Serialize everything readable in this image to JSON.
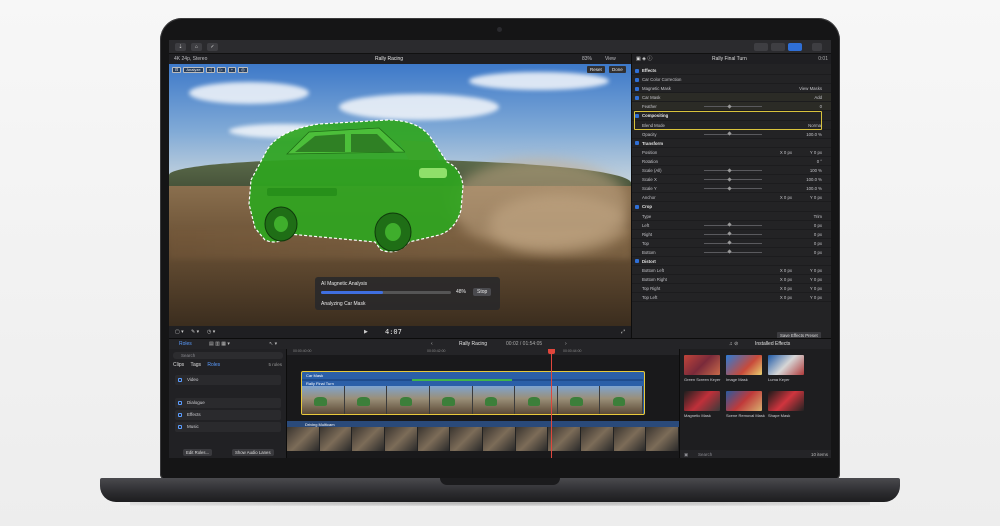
{
  "window": {
    "format_label": "4K 24p, Stereo",
    "project_name": "Rally Racing",
    "zoom": "83%",
    "view_menu": "View"
  },
  "viewer_tools": {
    "reset": "Reset",
    "done": "Done",
    "analyze": "Analyze"
  },
  "analysis": {
    "title": "AI Magnetic Analysis",
    "progress_percent": 48,
    "progress_label": "48%",
    "stop_label": "Stop",
    "status": "Analyzing Car Mask"
  },
  "transport": {
    "timecode": "4:07"
  },
  "inspector": {
    "clip_title": "Rally Final Turn",
    "duration": "0:01",
    "rows": [
      {
        "type": "section",
        "label": "Effects"
      },
      {
        "type": "check",
        "label": "Car Color Correction",
        "val": ""
      },
      {
        "type": "check",
        "label": "Magnetic Mask",
        "val": "View Masks"
      },
      {
        "type": "check",
        "label": "Car Mask",
        "val": "Add"
      },
      {
        "type": "slider",
        "label": "Feather",
        "val": "0"
      },
      {
        "type": "section",
        "label": "Compositing"
      },
      {
        "type": "plain",
        "label": "Blend Mode",
        "val": "Normal"
      },
      {
        "type": "slider",
        "label": "Opacity",
        "val": "100.0 %"
      },
      {
        "type": "section",
        "label": "Transform"
      },
      {
        "type": "xy",
        "label": "Position",
        "val": "X 0 px",
        "val2": "Y 0 px"
      },
      {
        "type": "plain",
        "label": "Rotation",
        "val": "0 °"
      },
      {
        "type": "slider",
        "label": "Scale (All)",
        "val": "100 %"
      },
      {
        "type": "slider",
        "label": "Scale X",
        "val": "100.0 %"
      },
      {
        "type": "slider",
        "label": "Scale Y",
        "val": "100.0 %"
      },
      {
        "type": "xy",
        "label": "Anchor",
        "val": "X 0 px",
        "val2": "Y 0 px"
      },
      {
        "type": "section",
        "label": "Crop"
      },
      {
        "type": "plain",
        "label": "Type",
        "val": "Trim"
      },
      {
        "type": "slider",
        "label": "Left",
        "val": "0 px"
      },
      {
        "type": "slider",
        "label": "Right",
        "val": "0 px"
      },
      {
        "type": "slider",
        "label": "Top",
        "val": "0 px"
      },
      {
        "type": "slider",
        "label": "Bottom",
        "val": "0 px"
      },
      {
        "type": "section",
        "label": "Distort"
      },
      {
        "type": "xy",
        "label": "Bottom Left",
        "val": "X 0 px",
        "val2": "Y 0 px"
      },
      {
        "type": "xy",
        "label": "Bottom Right",
        "val": "X 0 px",
        "val2": "Y 0 px"
      },
      {
        "type": "xy",
        "label": "Top Right",
        "val": "X 0 px",
        "val2": "Y 0 px"
      },
      {
        "type": "xy",
        "label": "Top Left",
        "val": "X 0 px",
        "val2": "Y 0 px"
      }
    ],
    "save_effects": "Save Effects Preset"
  },
  "browser": {
    "roles_label": "Roles",
    "search_placeholder": "Search",
    "tabs": [
      "Clips",
      "Tags",
      "Roles"
    ],
    "role_count": "5 roles",
    "roles": [
      "Video",
      "Dialogue",
      "Effects",
      "Music"
    ],
    "edit_roles": "Edit Roles...",
    "show_audio_lanes": "Show Audio Lanes"
  },
  "timeline": {
    "project_name": "Rally Racing",
    "time": "00:02 / 01:54:05",
    "ruler": [
      "00:00:40:00",
      "00:00:42:00",
      "00:00:44:00"
    ],
    "clip_mask_label": "Car Mask",
    "clip_label": "Rally Final Turn",
    "lower_clip_label": "Driving Multicam"
  },
  "effects_browser": {
    "title": "Installed Effects",
    "items": [
      "Green Screen Keyer",
      "Image Mask",
      "Luma Keyer",
      "Magnetic Mask",
      "Scene Removal Mask",
      "Shape Mask"
    ],
    "search_placeholder": "Search",
    "count": "10 items"
  }
}
